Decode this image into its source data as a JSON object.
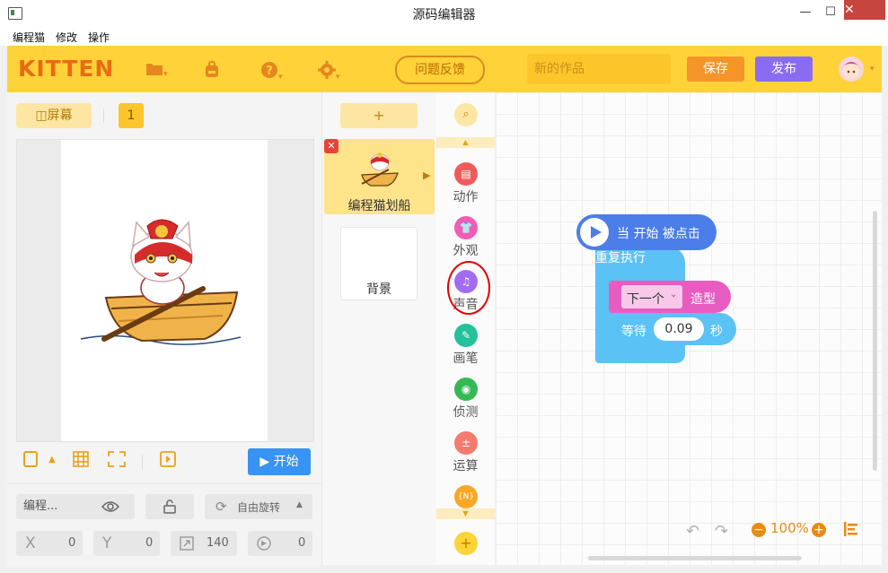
{
  "window": {
    "title": "源码编辑器",
    "minimize": "—",
    "maximize": "☐",
    "close": "✕"
  },
  "menu": [
    "编程猫",
    "修改",
    "操作"
  ],
  "toolbar": {
    "logo": "KITTEN",
    "feedback": "问题反馈",
    "project_name": "新的作品",
    "save": "保存",
    "publish": "发布",
    "colors": {
      "toolbar_bg": "#ffd23a",
      "save": "#f59428",
      "publish": "#8a6cf2"
    }
  },
  "stage": {
    "tab_label": "屏幕",
    "screen_number": "1",
    "start_button": "开始"
  },
  "properties": {
    "name": "编程...",
    "rotation_mode": "自由旋转",
    "x_label": "X",
    "x": "0",
    "y_label": "Y",
    "y": "0",
    "size": "140",
    "direction": "0"
  },
  "sprites": {
    "add": "+",
    "items": [
      {
        "label": "编程猫划船",
        "selected": true
      }
    ],
    "background_label": "背景"
  },
  "categories": [
    {
      "label": "动作",
      "color": "#f05a5a",
      "icon": "motion-icon"
    },
    {
      "label": "外观",
      "color": "#f25bb6",
      "icon": "appearance-icon"
    },
    {
      "label": "声音",
      "color": "#a36cf0",
      "icon": "sound-icon"
    },
    {
      "label": "画笔",
      "color": "#24c19b",
      "icon": "pen-icon"
    },
    {
      "label": "侦测",
      "color": "#34b955",
      "icon": "sensing-icon"
    },
    {
      "label": "运算",
      "color": "#f47c6e",
      "icon": "operator-icon"
    },
    {
      "label": "",
      "color": "#f9a825",
      "icon": "variable-icon",
      "glyph": "{N}"
    }
  ],
  "script": {
    "hat": "当 开始 被点击",
    "repeat": "重复执行",
    "costume_dropdown": "下一个",
    "costume_suffix": "造型",
    "wait_prefix": "等待",
    "wait_value": "0.09",
    "wait_suffix": "秒"
  },
  "workspace": {
    "zoom": "100%"
  }
}
